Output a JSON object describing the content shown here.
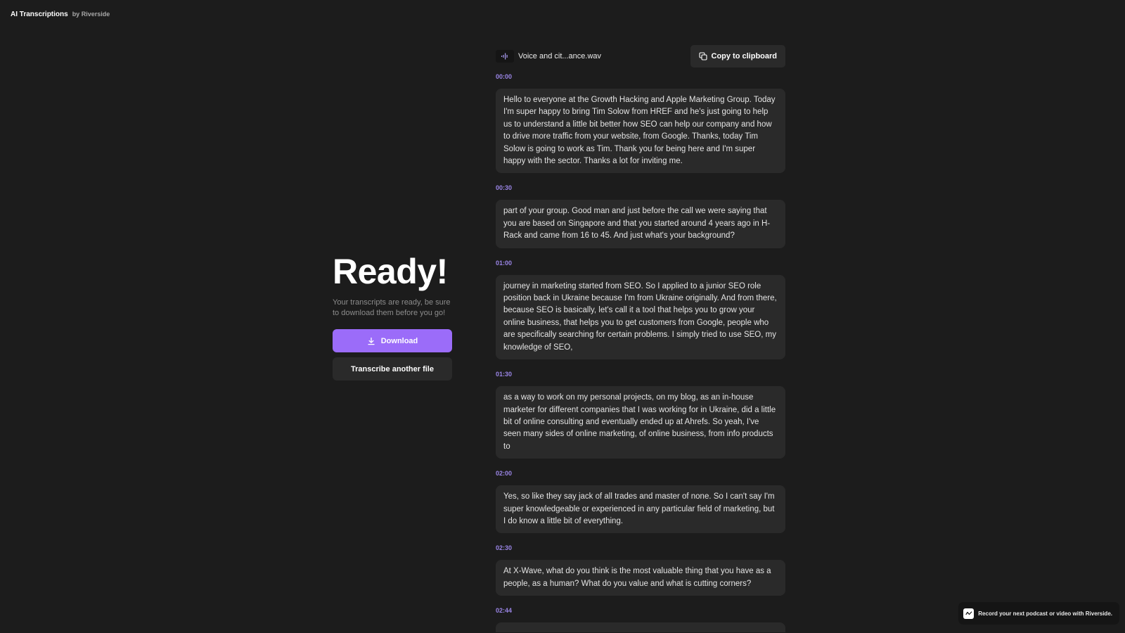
{
  "brand": {
    "title": "AI Transcriptions",
    "subtitle": "by Riverside"
  },
  "status": {
    "title": "Ready!",
    "description": "Your transcripts are ready, be sure to download them before you go!",
    "download_label": "Download",
    "transcribe_another_label": "Transcribe another file"
  },
  "file": {
    "icon": "audio-waveform-icon",
    "name": "Voice and cit...ance.wav",
    "copy_label": "Copy to clipboard",
    "copy_icon": "copy-icon"
  },
  "transcript": [
    {
      "time": "00:00",
      "text": "Hello to everyone at the Growth Hacking and Apple Marketing Group. Today I'm super happy to bring Tim Solow from HREF and he's just going to help us to understand a little bit better how SEO can help our company and how to drive more traffic from your website, from Google. Thanks, today Tim Solow is going to work as Tim. Thank you for being here and I'm super happy with the sector. Thanks a lot for inviting me."
    },
    {
      "time": "00:30",
      "text": "part of your group. Good man and just before the call we were saying that you are based on Singapore and that you started around 4 years ago in H-Rack and came from 16 to 45. And just what's your background?"
    },
    {
      "time": "01:00",
      "text": "journey in marketing started from SEO. So I applied to a junior SEO role position back in Ukraine because I'm from Ukraine originally. And from there, because SEO is basically, let's call it a tool that helps you to grow your online business, that helps you to get customers from Google, people who are specifically searching for certain problems. I simply tried to use SEO, my knowledge of SEO,"
    },
    {
      "time": "01:30",
      "text": "as a way to work on my personal projects, on my blog, as an in-house marketer for different companies that I was working for in Ukraine, did a little bit of online consulting and eventually ended up at Ahrefs. So yeah, I've seen many sides of online marketing, of online business, from info products to"
    },
    {
      "time": "02:00",
      "text": "Yes, so like they say jack of all trades and master of none. So I can't say I'm super knowledgeable or experienced in any particular field of marketing, but I do know a little bit of everything."
    },
    {
      "time": "02:30",
      "text": "At X-Wave, what do you think is the most valuable thing that you have as a people, as a human? What do you value and what is cutting corners?"
    },
    {
      "time": "02:44",
      "text": ""
    }
  ],
  "promo": {
    "icon": "riverside-logo-icon",
    "text": "Record your next podcast or video with Riverside."
  },
  "colors": {
    "background": "#1c1c1c",
    "accent": "#9b6cf9",
    "timestamp": "#9a85e6",
    "card": "#2a2a2a"
  }
}
